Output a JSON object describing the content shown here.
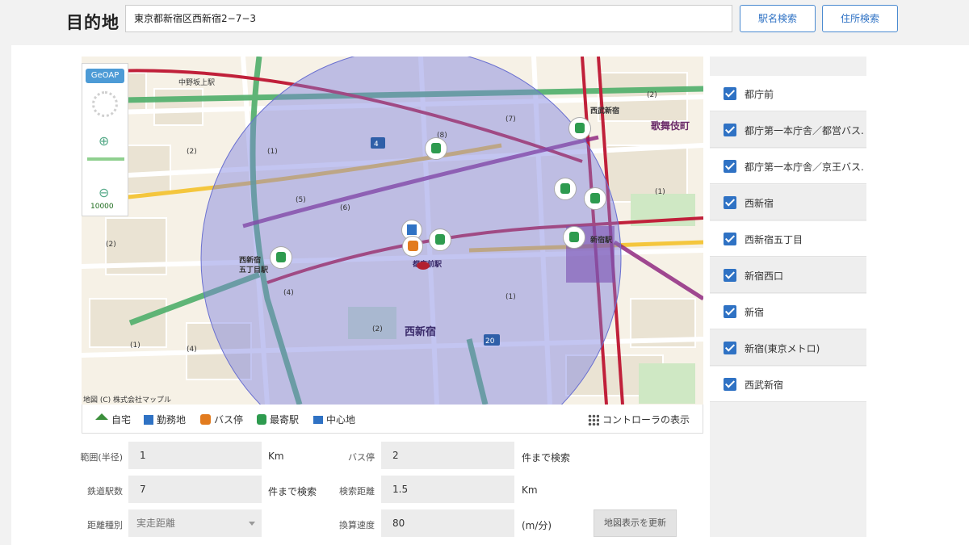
{
  "header": {
    "title": "目的地",
    "address_value": "東京都新宿区西新宿2−7−3",
    "station_search_label": "駅名検索",
    "address_search_label": "住所検索"
  },
  "map": {
    "badge": "GeOAP",
    "scale": "10000",
    "copyright": "地図 (C) 株式会社マップル",
    "center_station": "都庁前駅",
    "labels": {
      "area_west_shinjuku": "西新宿",
      "station_shinjuku": "新宿駅",
      "station_seibu": "西武新宿駅",
      "station_nishishinjuku5": "西新宿五丁目駅",
      "kabukicho": "歌舞伎町",
      "nakano_sakaue": "中野坂上駅",
      "road_20": "20",
      "road_4": "4"
    },
    "colors": {
      "circle_fill": "#7a7fe0",
      "station_marker": "#2e9b4f",
      "bus_marker": "#e27b1e",
      "home_marker": "#3c8f3c",
      "railway": "#c0203a"
    }
  },
  "legend": {
    "items": [
      {
        "icon": "home-icon",
        "label": "自宅"
      },
      {
        "icon": "office-icon",
        "label": "勤務地"
      },
      {
        "icon": "bus-icon",
        "label": "バス停"
      },
      {
        "icon": "train-icon",
        "label": "最寄駅"
      },
      {
        "icon": "flag-icon",
        "label": "中心地"
      }
    ],
    "controller_label": "コントローラの表示"
  },
  "form": {
    "radius_label": "範囲(半径)",
    "radius_value": "1",
    "radius_unit": "Km",
    "bus_label": "バス停",
    "bus_value": "2",
    "bus_unit": "件まで検索",
    "rail_count_label": "鉄道駅数",
    "rail_count_value": "7",
    "rail_count_unit": "件まで検索",
    "search_distance_label": "検索距離",
    "search_distance_value": "1.5",
    "search_distance_unit": "Km",
    "distance_type_label": "距離種別",
    "distance_type_value": "実走距離",
    "speed_label": "換算速度",
    "speed_value": "80",
    "speed_unit": "(m/分)",
    "update_button": "地図表示を更新"
  },
  "stations": [
    {
      "name": "都庁前",
      "checked": true
    },
    {
      "name": "都庁第一本庁舎／都営バス...",
      "checked": true
    },
    {
      "name": "都庁第一本庁舎／京王バス...",
      "checked": true
    },
    {
      "name": "西新宿",
      "checked": true
    },
    {
      "name": "西新宿五丁目",
      "checked": true
    },
    {
      "name": "新宿西口",
      "checked": true
    },
    {
      "name": "新宿",
      "checked": true
    },
    {
      "name": "新宿(東京メトロ)",
      "checked": true
    },
    {
      "name": "西武新宿",
      "checked": true
    }
  ]
}
